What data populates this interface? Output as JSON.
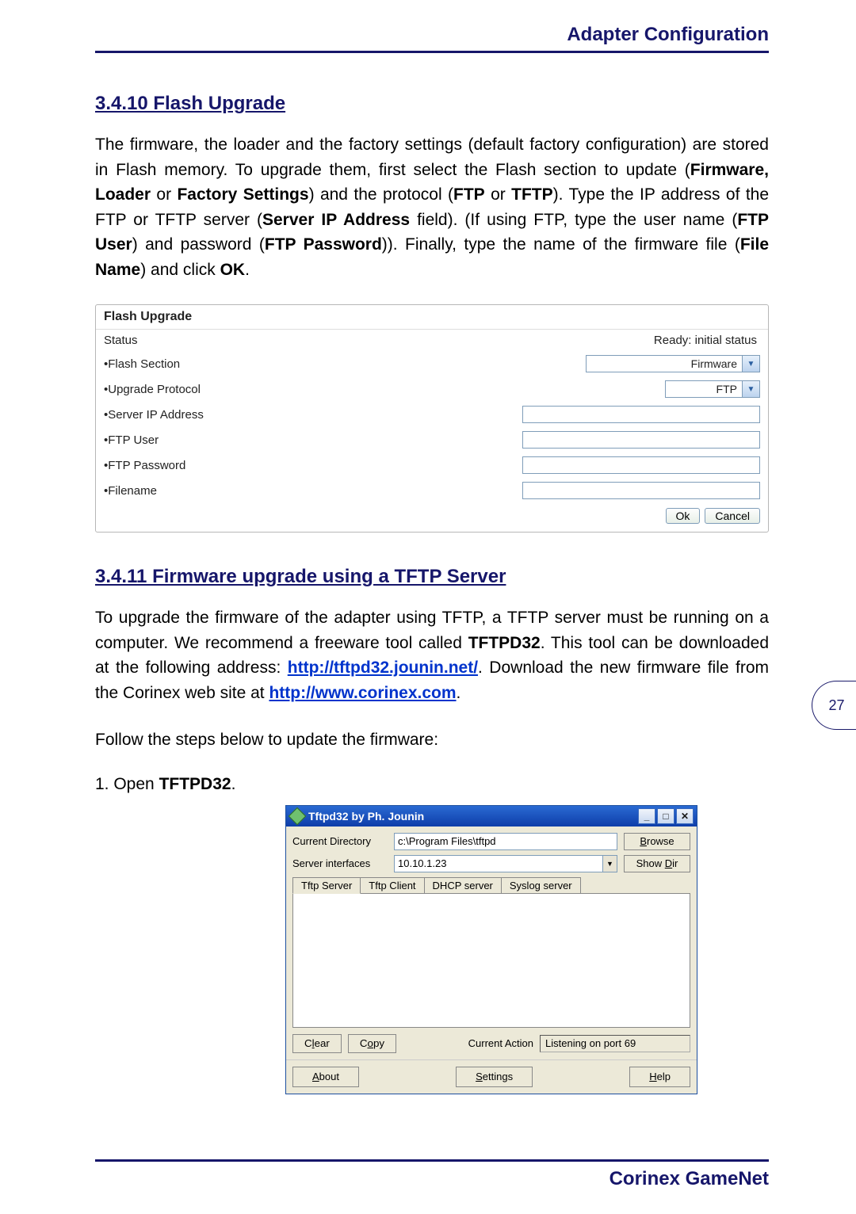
{
  "header": {
    "title": "Adapter Configuration"
  },
  "footer": {
    "brand": "Corinex GameNet"
  },
  "page_number": "27",
  "sections": {
    "s1_heading": "3.4.10 Flash Upgrade",
    "s1_para": "The firmware, the loader and the factory settings (default factory configuration) are stored in Flash memory. To upgrade them, first select the Flash section to update (Firmware, Loader or Factory Settings) and the protocol (FTP or TFTP). Type the IP address of the FTP or TFTP server (Server IP Address field). (If using FTP, type the user name (FTP User) and password (FTP Password)). Finally, type the name of the firmware file (File Name) and click OK.",
    "s2_heading": "3.4.11  Firmware upgrade using a TFTP Server",
    "s2_para_pre": "To upgrade the firmware of the adapter using TFTP, a TFTP server must be running on a computer. We recommend a freeware tool called ",
    "s2_para_tool": "TFTPD32",
    "s2_para_mid1": ". This tool can be downloaded at the following address: ",
    "s2_link1": "http://tftpd32.jounin.net/",
    "s2_para_mid2": ". Download the new firmware file from the Corinex web site at ",
    "s2_link2": "http://www.corinex.com",
    "s2_para_end": ".",
    "s2_follow": "Follow the steps below to update the firmware:",
    "s2_step1_pre": "1.  Open ",
    "s2_step1_bold": "TFTPD32",
    "s2_step1_end": "."
  },
  "flash_panel": {
    "title": "Flash Upgrade",
    "rows": {
      "status_label": "Status",
      "status_value": "Ready: initial status",
      "flash_section_label": "•Flash Section",
      "flash_section_value": "Firmware",
      "upgrade_protocol_label": "•Upgrade Protocol",
      "upgrade_protocol_value": "FTP",
      "server_ip_label": "•Server IP Address",
      "ftp_user_label": "•FTP User",
      "ftp_password_label": "•FTP Password",
      "filename_label": "•Filename"
    },
    "buttons": {
      "ok": "Ok",
      "cancel": "Cancel"
    }
  },
  "tftp_window": {
    "title": "Tftpd32 by Ph. Jounin",
    "current_dir_label": "Current Directory",
    "current_dir_value": "c:\\Program Files\\tftpd",
    "browse": "Browse",
    "server_if_label": "Server interfaces",
    "server_if_value": "10.10.1.23",
    "show_dir": "Show Dir",
    "tabs": {
      "t1": "Tftp Server",
      "t2": "Tftp Client",
      "t3": "DHCP server",
      "t4": "Syslog server"
    },
    "clear": "Clear",
    "copy": "Copy",
    "current_action_label": "Current Action",
    "current_action_value": "Listening on port 69",
    "about": "About",
    "settings": "Settings",
    "help": "Help"
  }
}
